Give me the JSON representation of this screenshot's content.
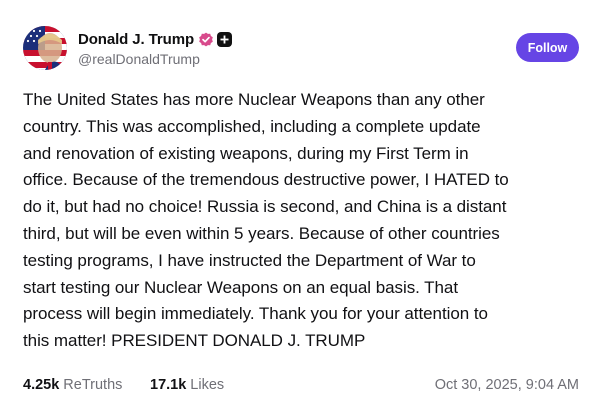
{
  "author": {
    "display_name": "Donald J. Trump",
    "handle": "@realDonaldTrump",
    "avatar_icon": "flag-portrait-avatar",
    "verified_icon": "verified-badge-icon",
    "verified_color": "#d84a8c",
    "plus_icon": "plus-badge-icon"
  },
  "follow": {
    "label": "Follow",
    "color": "#6645e5"
  },
  "post": {
    "lines": [
      "The United States has more Nuclear Weapons than any other",
      "country. This was accomplished, including a complete update",
      "and renovation of existing weapons, during my First Term in",
      "office. Because of the tremendous destructive power, I HATED to",
      "do it, but had no choice! Russia is second, and China is a distant",
      "third, but will be even within 5 years. Because of other countries",
      "testing programs, I have instructed the Department of War to",
      "start testing our Nuclear Weapons on an equal basis. That",
      "process will begin immediately. Thank you for your attention to",
      "this matter! PRESIDENT DONALD J. TRUMP"
    ]
  },
  "stats": {
    "retruths_count": "4.25k",
    "retruths_label": "ReTruths",
    "likes_count": "17.1k",
    "likes_label": "Likes"
  },
  "timestamp": "Oct 30, 2025, 9:04 AM"
}
